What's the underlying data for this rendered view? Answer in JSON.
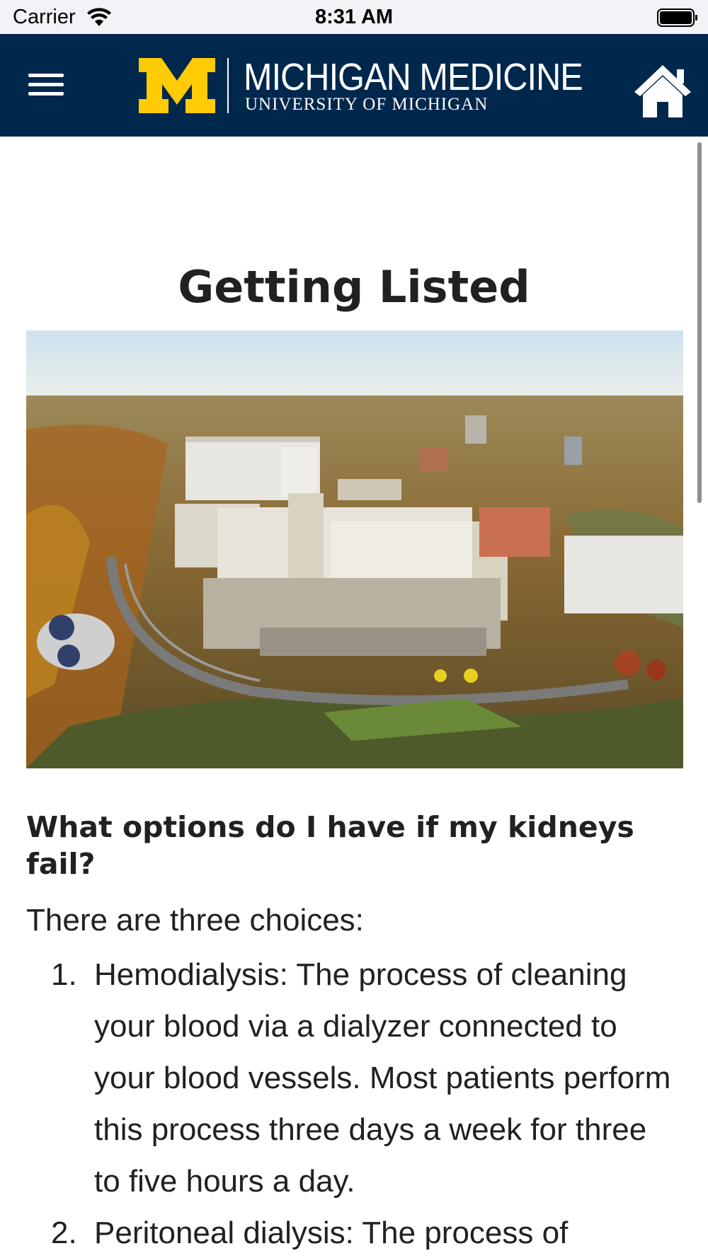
{
  "status_bar": {
    "carrier": "Carrier",
    "time": "8:31 AM"
  },
  "header": {
    "brand_main": "MICHIGAN MEDICINE",
    "brand_sub": "UNIVERSITY OF MICHIGAN",
    "menu_icon": "hamburger-menu-icon",
    "home_icon": "home-icon",
    "colors": {
      "navy": "#00274c",
      "maize": "#ffcb05"
    }
  },
  "page": {
    "title": "Getting Listed",
    "section_heading": "What options do I have if my kidneys fail?",
    "intro": "There are three choices:",
    "options": [
      {
        "number": "1.",
        "text": "Hemodialysis: The process of cleaning your blood via a dialyzer connected to your blood vessels. Most patients perform this process three days a week for three to five hours a day."
      },
      {
        "number": "2.",
        "text": "Peritoneal dialysis: The process of"
      }
    ]
  }
}
